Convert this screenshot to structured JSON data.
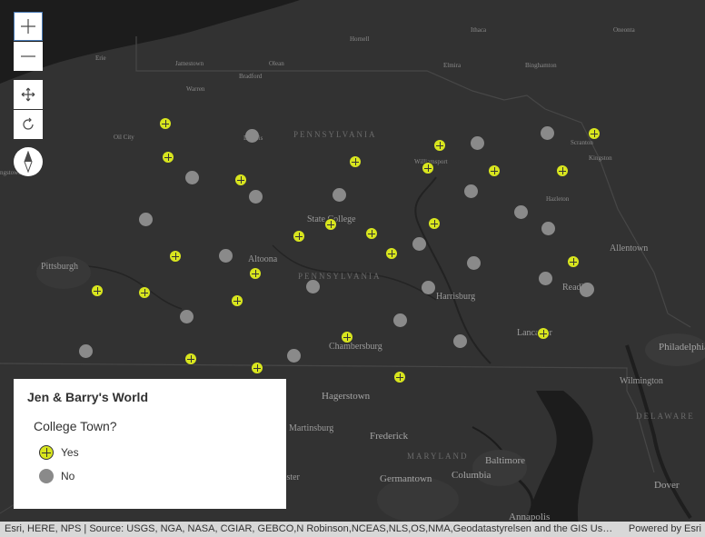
{
  "map": {
    "places": [
      {
        "id": "erie",
        "text": "Erie",
        "size": "s"
      },
      {
        "id": "jamestown",
        "text": "Jamestown",
        "size": "s"
      },
      {
        "id": "olean",
        "text": "Olean",
        "size": "s"
      },
      {
        "id": "bradford",
        "text": "Bradford",
        "size": "s"
      },
      {
        "id": "warren",
        "text": "Warren",
        "size": "s"
      },
      {
        "id": "hornell",
        "text": "Hornell",
        "size": "s"
      },
      {
        "id": "ithaca",
        "text": "Ithaca",
        "size": "s"
      },
      {
        "id": "oneonta",
        "text": "Oneonta",
        "size": "s"
      },
      {
        "id": "elmira",
        "text": "Elmira",
        "size": "s"
      },
      {
        "id": "binghamton",
        "text": "Binghamton",
        "size": "s"
      },
      {
        "id": "oilcity",
        "text": "Oil City",
        "size": "s"
      },
      {
        "id": "dubois",
        "text": "DuBois",
        "size": "s"
      },
      {
        "id": "pennsylvania-top",
        "text": "PENNSYLVANIA",
        "size": "state"
      },
      {
        "id": "williamsport",
        "text": "Williamsport",
        "size": "s"
      },
      {
        "id": "scranton",
        "text": "Scranton",
        "size": "s"
      },
      {
        "id": "hazleton",
        "text": "Hazleton",
        "size": "s"
      },
      {
        "id": "kingston",
        "text": "Kingston",
        "size": "s"
      },
      {
        "id": "statecollege",
        "text": "State College",
        "size": "n"
      },
      {
        "id": "allentown",
        "text": "Allentown",
        "size": "n"
      },
      {
        "id": "pittsburgh",
        "text": "Pittsburgh",
        "size": "n"
      },
      {
        "id": "altoona",
        "text": "Altoona",
        "size": "n"
      },
      {
        "id": "pennsylvania-mid",
        "text": "PENNSYLVANIA",
        "size": "state"
      },
      {
        "id": "reading",
        "text": "Reading",
        "size": "n"
      },
      {
        "id": "harrisburg",
        "text": "Harrisburg",
        "size": "n"
      },
      {
        "id": "lancaster",
        "text": "Lancaster",
        "size": "n"
      },
      {
        "id": "philadelphia",
        "text": "Philadelphia",
        "size": "m"
      },
      {
        "id": "chambersburg",
        "text": "Chambersburg",
        "size": "n"
      },
      {
        "id": "hagerstown",
        "text": "Hagerstown",
        "size": "m"
      },
      {
        "id": "wilmington",
        "text": "Wilmington",
        "size": "n"
      },
      {
        "id": "martinsburg",
        "text": "Martinsburg",
        "size": "n"
      },
      {
        "id": "frederick",
        "text": "Frederick",
        "size": "m"
      },
      {
        "id": "maryland",
        "text": "MARYLAND",
        "size": "state"
      },
      {
        "id": "baltimore",
        "text": "Baltimore",
        "size": "m"
      },
      {
        "id": "germantown",
        "text": "Germantown",
        "size": "m"
      },
      {
        "id": "columbia",
        "text": "Columbia",
        "size": "m"
      },
      {
        "id": "dover",
        "text": "Dover",
        "size": "m"
      },
      {
        "id": "annapolis",
        "text": "Annapolis",
        "size": "m"
      },
      {
        "id": "delaware",
        "text": "DELAWARE",
        "size": "state"
      },
      {
        "id": "winchester",
        "text": "ester",
        "size": "n"
      },
      {
        "id": "morgantown",
        "text": "ngstown",
        "size": "s"
      }
    ],
    "towns": [
      {
        "college": "Yes"
      },
      {
        "college": "No"
      },
      {
        "college": "Yes"
      },
      {
        "college": "No"
      },
      {
        "college": "Yes"
      },
      {
        "college": "No"
      },
      {
        "college": "No"
      },
      {
        "college": "Yes"
      },
      {
        "college": "No"
      },
      {
        "college": "Yes"
      },
      {
        "college": "Yes"
      },
      {
        "college": "No"
      },
      {
        "college": "Yes"
      },
      {
        "college": "No"
      },
      {
        "college": "Yes"
      },
      {
        "college": "No"
      },
      {
        "college": "Yes"
      },
      {
        "college": "Yes"
      },
      {
        "college": "No"
      },
      {
        "college": "Yes"
      },
      {
        "college": "Yes"
      },
      {
        "college": "No"
      },
      {
        "college": "No"
      },
      {
        "college": "Yes"
      },
      {
        "college": "Yes"
      },
      {
        "college": "No"
      },
      {
        "college": "No"
      },
      {
        "college": "Yes"
      },
      {
        "college": "Yes"
      },
      {
        "college": "No"
      },
      {
        "college": "No"
      },
      {
        "college": "No"
      },
      {
        "college": "Yes"
      },
      {
        "college": "No"
      },
      {
        "college": "No"
      },
      {
        "college": "Yes"
      },
      {
        "college": "No"
      },
      {
        "college": "No"
      },
      {
        "college": "Yes"
      },
      {
        "college": "No"
      },
      {
        "college": "Yes"
      },
      {
        "college": "Yes"
      },
      {
        "college": "No"
      },
      {
        "college": "Yes"
      },
      {
        "college": "Yes"
      },
      {
        "college": "No"
      },
      {
        "college": "Yes"
      },
      {
        "college": "Yes"
      }
    ]
  },
  "controls": {
    "zoom_in": "plus-icon",
    "zoom_out": "minus-icon",
    "pan": "pan-icon",
    "rotate": "rotate-icon",
    "compass": "compass-icon"
  },
  "legend": {
    "title": "Jen & Barry's World",
    "field": "College Town?",
    "items": [
      {
        "label": "Yes",
        "color": "#d8e51e"
      },
      {
        "label": "No",
        "color": "#8a8a8a"
      }
    ]
  },
  "attribution": {
    "sources": "Esri, HERE, NPS | Source: USGS, NGA, NASA, CGIAR, GEBCO,N Robinson,NCEAS,NLS,OS,NMA,Geodatastyrelsen and the GIS User Community",
    "powered_by": "Powered by Esri"
  },
  "colors": {
    "land": "#323232",
    "water": "#1a1a1a",
    "yes": "#d8e51e",
    "no": "#8a8a8a"
  }
}
